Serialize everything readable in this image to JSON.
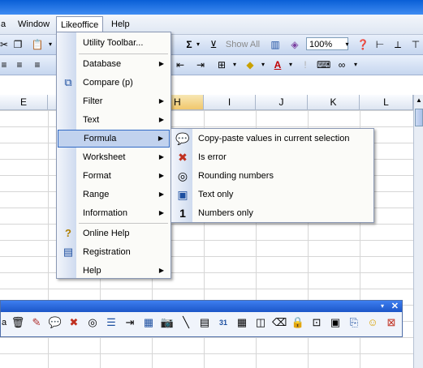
{
  "menubar": {
    "items": [
      {
        "label": "a"
      },
      {
        "label": "Window"
      },
      {
        "label": "Likeoffice"
      },
      {
        "label": "Help"
      }
    ]
  },
  "toolbar": {
    "show_all_label": "Show All",
    "zoom_value": "100%"
  },
  "formatting_toolbar": {
    "font_color_glyph": "A"
  },
  "columns": [
    {
      "label": "E"
    },
    {
      "label": "F"
    },
    {
      "label": "G"
    },
    {
      "label": "H"
    },
    {
      "label": "I"
    },
    {
      "label": "J"
    },
    {
      "label": "K"
    },
    {
      "label": "L"
    }
  ],
  "likeoffice_menu": {
    "items": [
      {
        "label": "Utility Toolbar...",
        "icon": "none",
        "has_submenu": false
      },
      {
        "label": "Database",
        "icon": "none",
        "has_submenu": true
      },
      {
        "label": "Compare (p)",
        "icon": "compare-icon",
        "has_submenu": false
      },
      {
        "label": "Filter",
        "icon": "none",
        "has_submenu": true
      },
      {
        "label": "Text",
        "icon": "none",
        "has_submenu": true
      },
      {
        "label": "Formula",
        "icon": "none",
        "has_submenu": true
      },
      {
        "label": "Worksheet",
        "icon": "none",
        "has_submenu": true
      },
      {
        "label": "Format",
        "icon": "none",
        "has_submenu": true
      },
      {
        "label": "Range",
        "icon": "none",
        "has_submenu": true
      },
      {
        "label": "Information",
        "icon": "none",
        "has_submenu": true
      },
      {
        "label": "Online Help",
        "icon": "question-icon",
        "has_submenu": false
      },
      {
        "label": "Registration",
        "icon": "registration-icon",
        "has_submenu": false
      },
      {
        "label": "Help",
        "icon": "none",
        "has_submenu": true
      }
    ]
  },
  "formula_submenu": {
    "items": [
      {
        "label": "Copy-paste values in current selection",
        "icon": "speech-bubble-icon"
      },
      {
        "label": "Is error",
        "icon": "error-icon"
      },
      {
        "label": "Rounding numbers",
        "icon": "circle-icon"
      },
      {
        "label": "Text only",
        "icon": "text-box-icon"
      },
      {
        "label": "Numbers only",
        "icon": "number-one-icon",
        "icon_glyph": "1"
      }
    ]
  },
  "drawbar": {
    "left_text": "a"
  },
  "colors": {
    "highlight": "#c1d2ee",
    "highlight_border": "#316ac5",
    "title_blue": "#1c56c8"
  }
}
